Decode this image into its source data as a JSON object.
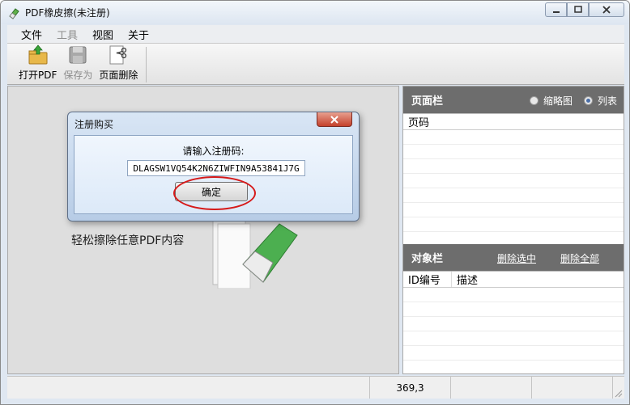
{
  "window": {
    "title": "PDF橡皮擦(未注册)"
  },
  "menu": [
    {
      "label": "文件",
      "enabled": true
    },
    {
      "label": "工具",
      "enabled": false
    },
    {
      "label": "视图",
      "enabled": true
    },
    {
      "label": "关于",
      "enabled": true
    }
  ],
  "toolbar": {
    "open_label": "打开PDF",
    "save_label": "保存为",
    "delete_label": "页面删除"
  },
  "main": {
    "tagline": "轻松擦除任意PDF内容"
  },
  "pages_panel": {
    "title": "页面栏",
    "radio_thumb": "缩略图",
    "radio_list": "列表",
    "selected_view": "列表",
    "col_page": "页码"
  },
  "objects_panel": {
    "title": "对象栏",
    "delete_selected": "删除选中",
    "delete_all": "删除全部",
    "col_id": "ID编号",
    "col_desc": "描述"
  },
  "status": {
    "coords": "369,3"
  },
  "dialog": {
    "title": "注册购买",
    "prompt": "请输入注册码:",
    "code_value": "DLAGSW1VQ54K2N6ZIWFIN9A53841J7G",
    "ok_label": "确定"
  },
  "colors": {
    "panel_header": "#6d6d6d",
    "highlight_ellipse": "#d61a1a"
  }
}
